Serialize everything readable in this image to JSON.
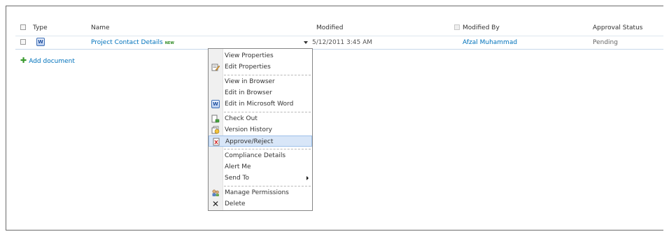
{
  "columns": {
    "type": "Type",
    "name": "Name",
    "modified": "Modified",
    "modified_by": "Modified By",
    "approval_status": "Approval Status"
  },
  "row": {
    "name": "Project Contact Details",
    "new_badge": "NEW",
    "modified": "5/12/2011 3:45 AM",
    "modified_by": "Afzal Muhammad",
    "approval_status": "Pending"
  },
  "add_document": "Add document",
  "menu": {
    "items": [
      {
        "label": "View Properties",
        "icon": ""
      },
      {
        "label": "Edit Properties",
        "icon": "edit-properties-icon"
      },
      {
        "label": "View in Browser",
        "icon": ""
      },
      {
        "label": "Edit in Browser",
        "icon": ""
      },
      {
        "label": "Edit in Microsoft Word",
        "icon": "word-icon"
      },
      {
        "label": "Check Out",
        "icon": "check-out-icon"
      },
      {
        "label": "Version History",
        "icon": "version-history-icon"
      },
      {
        "label": "Approve/Reject",
        "icon": "approve-reject-icon"
      },
      {
        "label": "Compliance Details",
        "icon": ""
      },
      {
        "label": "Alert Me",
        "icon": ""
      },
      {
        "label": "Send To",
        "icon": "submenu-arrow-icon"
      },
      {
        "label": "Manage Permissions",
        "icon": "manage-permissions-icon"
      },
      {
        "label": "Delete",
        "icon": "delete-icon"
      }
    ],
    "highlighted_item": "Approve/Reject"
  },
  "colors": {
    "link": "#0072bc",
    "highlight": "#d8e6f8",
    "add_icon": "#3a9a2e"
  }
}
